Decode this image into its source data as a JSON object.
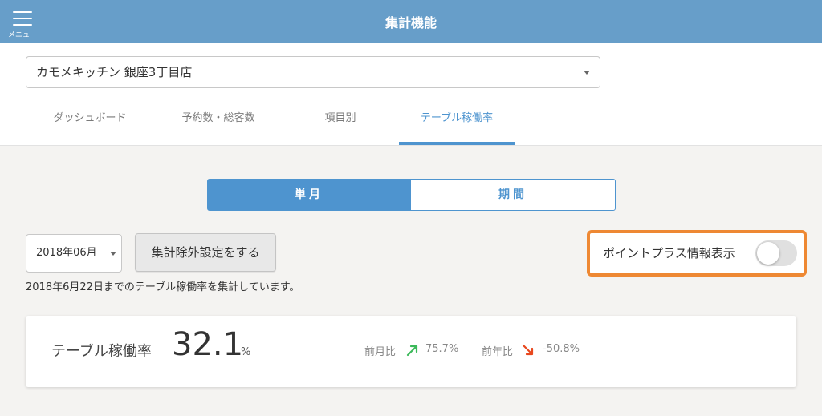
{
  "header": {
    "menu_label": "メニュー",
    "title": "集計機能"
  },
  "store_select": {
    "value": "カモメキッチン 銀座3丁目店"
  },
  "tabs": [
    {
      "label": "ダッシュボード",
      "active": false
    },
    {
      "label": "予約数・総客数",
      "active": false
    },
    {
      "label": "項目別",
      "active": false
    },
    {
      "label": "テーブル稼働率",
      "active": true
    }
  ],
  "segment": {
    "single_month": "単月",
    "period": "期間",
    "selected": "single_month"
  },
  "controls": {
    "month_value": "2018年06月",
    "exclude_button": "集計除外設定をする",
    "point_plus_label": "ポイントプラス情報表示",
    "point_plus_on": false
  },
  "note": "2018年6月22日までのテーブル稼働率を集計しています。",
  "summary": {
    "label": "テーブル稼働率",
    "value": "32.1",
    "unit": "%",
    "prev_month_label": "前月比",
    "prev_month_value": "75.7%",
    "prev_month_trend": "up",
    "prev_year_label": "前年比",
    "prev_year_value": "-50.8%",
    "prev_year_trend": "down"
  },
  "colors": {
    "header_bg": "#679ec9",
    "accent": "#4e94cf",
    "highlight_border": "#ee8833",
    "trend_up": "#3cb95a",
    "trend_down": "#e8481e"
  }
}
